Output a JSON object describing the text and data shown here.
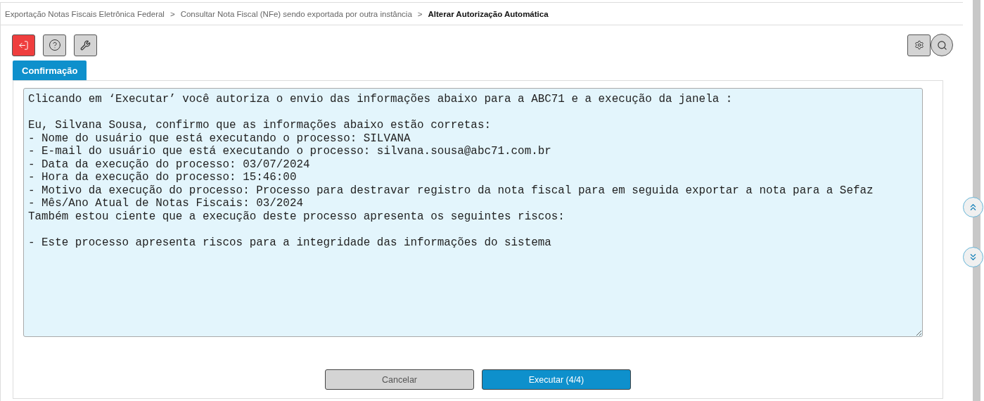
{
  "breadcrumb": [
    {
      "label": "Exportação Notas Fiscais Eletrônica Federal",
      "current": false
    },
    {
      "label": "Consultar Nota Fiscal (NFe) sendo exportada por outra instância",
      "current": false
    },
    {
      "label": "Alterar Autorização Automática",
      "current": true
    }
  ],
  "breadcrumb_separator": ">",
  "tabs": [
    {
      "label": "Confirmação",
      "selected": true
    }
  ],
  "message": {
    "paragraphs": [
      [
        "Clicando em ‘Executar’ você autoriza o envio das informações abaixo para a ABC71 e a execução da janela :"
      ],
      [
        "Eu, Silvana Sousa, confirmo que as informações abaixo estão corretas:",
        "- Nome do usuário que está executando o processo: SILVANA",
        "- E-mail do usuário que está executando o processo: silvana.sousa@abc71.com.br",
        "- Data da execução do processo: 03/07/2024",
        "- Hora da execução do processo: 15:46:00",
        "- Motivo da execução do processo: Processo para destravar registro da nota fiscal para em seguida exportar a nota para a Sefaz",
        "- Mês/Ano Atual de Notas Fiscais: 03/2024",
        "Também estou ciente que a execução deste processo apresenta os seguintes riscos:"
      ],
      [
        "- Este processo apresenta riscos para a integridade das informações do sistema"
      ]
    ]
  },
  "buttons": [
    {
      "label": "Cancelar",
      "kind": "secondary"
    },
    {
      "label": "Executar (4/4)",
      "kind": "primary"
    }
  ]
}
